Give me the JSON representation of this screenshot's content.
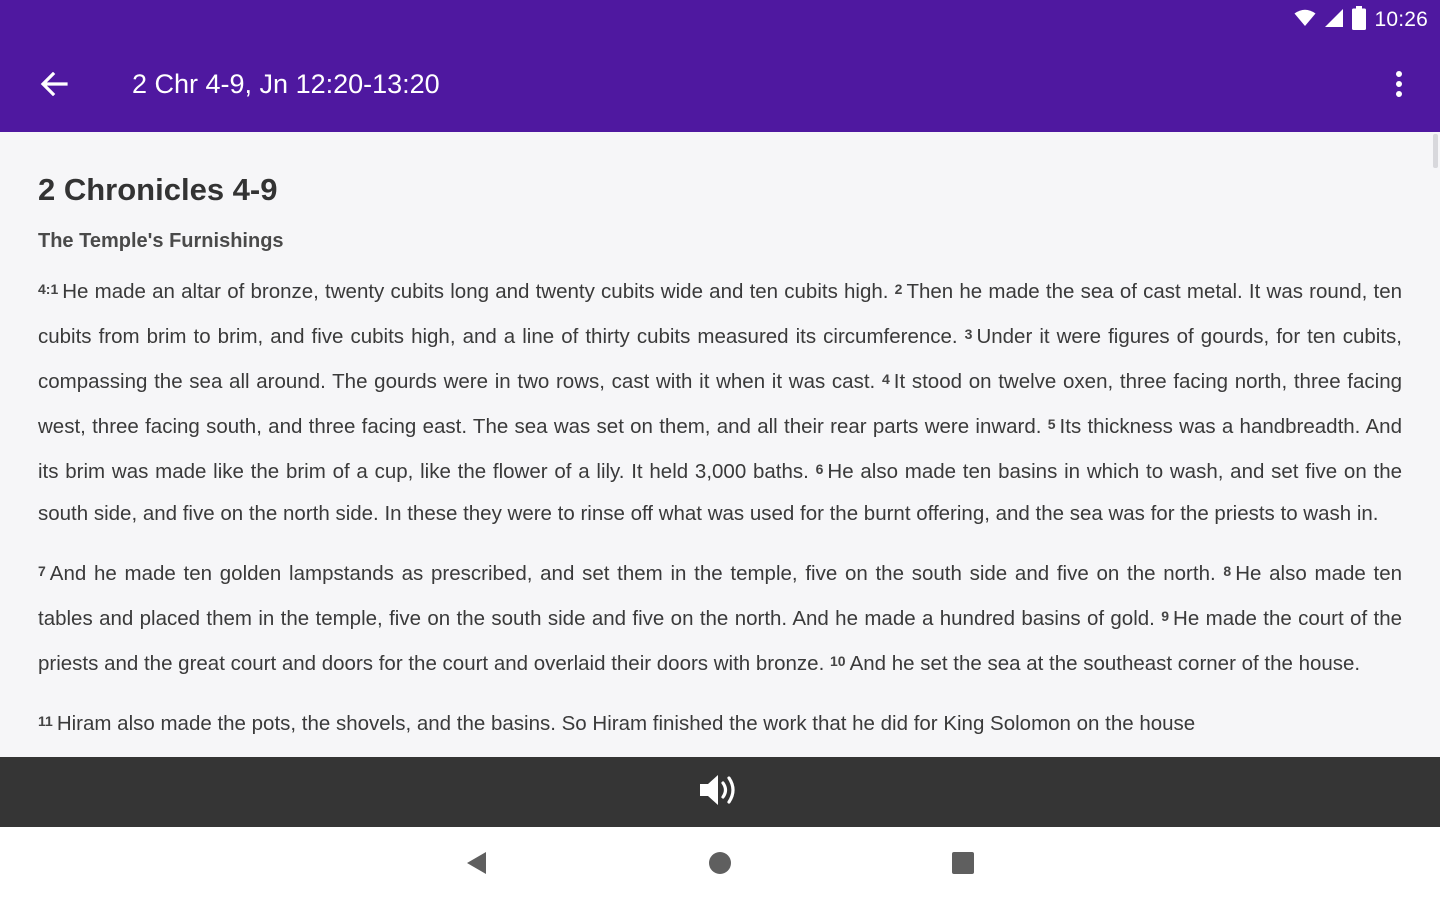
{
  "status_bar": {
    "time": "10:26",
    "icons": [
      "wifi-icon",
      "cellular-signal-icon",
      "battery-icon"
    ]
  },
  "toolbar": {
    "title": "2 Chr 4-9, Jn 12:20-13:20",
    "back_icon": "arrow-left-icon",
    "menu_icon": "more-vertical-icon",
    "background_color": "#4f18a0"
  },
  "reading": {
    "book_title": "2 Chronicles 4-9",
    "section_heading": "The Temple's Furnishings",
    "paragraphs": [
      [
        {
          "num": "4:1",
          "text": "He made an altar of bronze, twenty cubits long and twenty cubits wide and ten cubits high."
        },
        {
          "num": "2",
          "text": "Then he made the sea of cast metal. It was round, ten cubits from brim to brim, and five cubits high, and a line of thirty cubits measured its circumference."
        },
        {
          "num": "3",
          "text": "Under it were figures of gourds, for ten cubits, compassing the sea all around. The gourds were in two rows, cast with it when it was cast."
        },
        {
          "num": "4",
          "text": "It stood on twelve oxen, three facing north, three facing west, three facing south, and three facing east. The sea was set on them, and all their rear parts were inward."
        },
        {
          "num": "5",
          "text": "Its thickness was a handbreadth. And its brim was made like the brim of a cup, like the flower of a lily. It held 3,000 baths."
        },
        {
          "num": "6",
          "text": "He also made ten basins in which to wash, and set five on the south side, and five on the north side. In these they were to rinse off what was used for the burnt offering, and the sea was for the priests to wash in."
        }
      ],
      [
        {
          "num": "7",
          "text": "And he made ten golden lampstands as prescribed, and set them in the temple, five on the south side and five on the north."
        },
        {
          "num": "8",
          "text": "He also made ten tables and placed them in the temple, five on the south side and five on the north. And he made a hundred basins of gold."
        },
        {
          "num": "9",
          "text": "He made the court of the priests and the great court and doors for the court and overlaid their doors with bronze."
        },
        {
          "num": "10",
          "text": "And he set the sea at the southeast corner of the house."
        }
      ],
      [
        {
          "num": "11",
          "text": "Hiram also made the pots, the shovels, and the basins. So Hiram finished the work that he did for King Solomon on the house"
        }
      ]
    ]
  },
  "audio_player": {
    "icon": "volume-icon"
  },
  "system_nav": {
    "back_icon": "triangle-back-icon",
    "home_icon": "circle-home-icon",
    "recents_icon": "square-recents-icon"
  }
}
